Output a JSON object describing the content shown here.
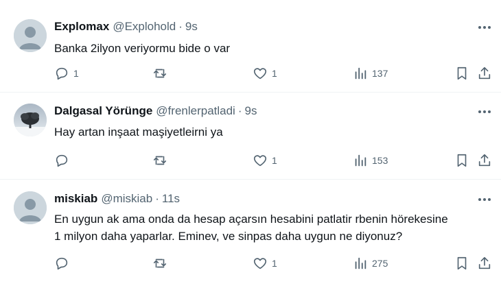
{
  "tweets": [
    {
      "name": "Explomax",
      "handle": "@Explohold",
      "separator": "·",
      "time": "9s",
      "text": "Banka 2ilyon veriyormu bide o var",
      "avatar": "default-avatar",
      "replies": "1",
      "retweets": "",
      "likes": "1",
      "views": "137"
    },
    {
      "name": "Dalgasal Yörünge",
      "handle": "@frenlerpatladi",
      "separator": "·",
      "time": "9s",
      "text": "Hay artan inşaat maşiyetleirni ya",
      "avatar": "tree-photo-avatar",
      "replies": "",
      "retweets": "",
      "likes": "1",
      "views": "153"
    },
    {
      "name": "miskiab",
      "handle": "@miskiab",
      "separator": "·",
      "time": "11s",
      "text": "En uygun ak ama onda da hesap açarsın hesabini patlatir rbenin hörekesine 1 milyon daha yaparlar. Eminev, ve sinpas daha uygun ne diyonuz?",
      "avatar": "default-avatar",
      "replies": "",
      "retweets": "",
      "likes": "1",
      "views": "275"
    }
  ],
  "colors": {
    "text": "#0f1419",
    "secondary": "#536471",
    "divider": "#eff3f4",
    "avatar_bg": "#ccd6dd"
  }
}
